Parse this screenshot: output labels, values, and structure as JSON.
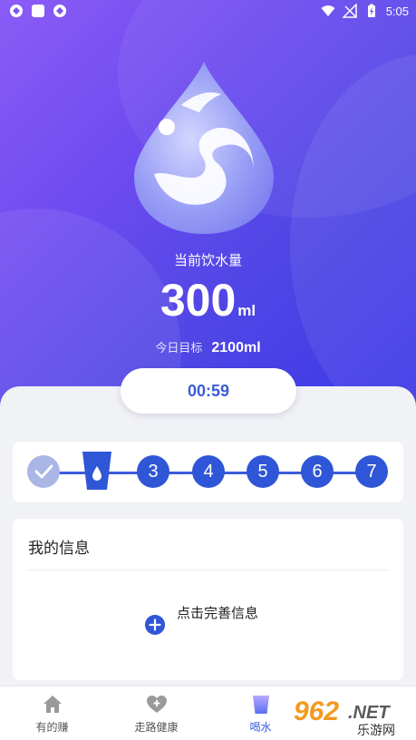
{
  "statusbar": {
    "time": "5:05"
  },
  "hero": {
    "intake_label": "当前饮水量",
    "intake_value": "300",
    "intake_unit": "ml",
    "goal_label": "今日目标",
    "goal_value": "2100ml"
  },
  "timer": {
    "value": "00:59"
  },
  "steps": {
    "items": [
      "3",
      "4",
      "5",
      "6",
      "7"
    ]
  },
  "info": {
    "title": "我的信息",
    "add_text": "点击完善信息"
  },
  "tabs": [
    {
      "label": "有的赚",
      "icon": "home-icon"
    },
    {
      "label": "走路健康",
      "icon": "heart-plus-icon"
    },
    {
      "label": "喝水",
      "icon": "cup-icon"
    },
    {
      "label": "",
      "icon": ""
    }
  ],
  "watermark": {
    "main": "962",
    "dot": ".NET",
    "sub": "乐游网"
  },
  "colors": {
    "accent": "#2f56d6",
    "hero_start": "#8b5cf6",
    "hero_end": "#3b38e8",
    "done_step": "#a9b6e6"
  }
}
